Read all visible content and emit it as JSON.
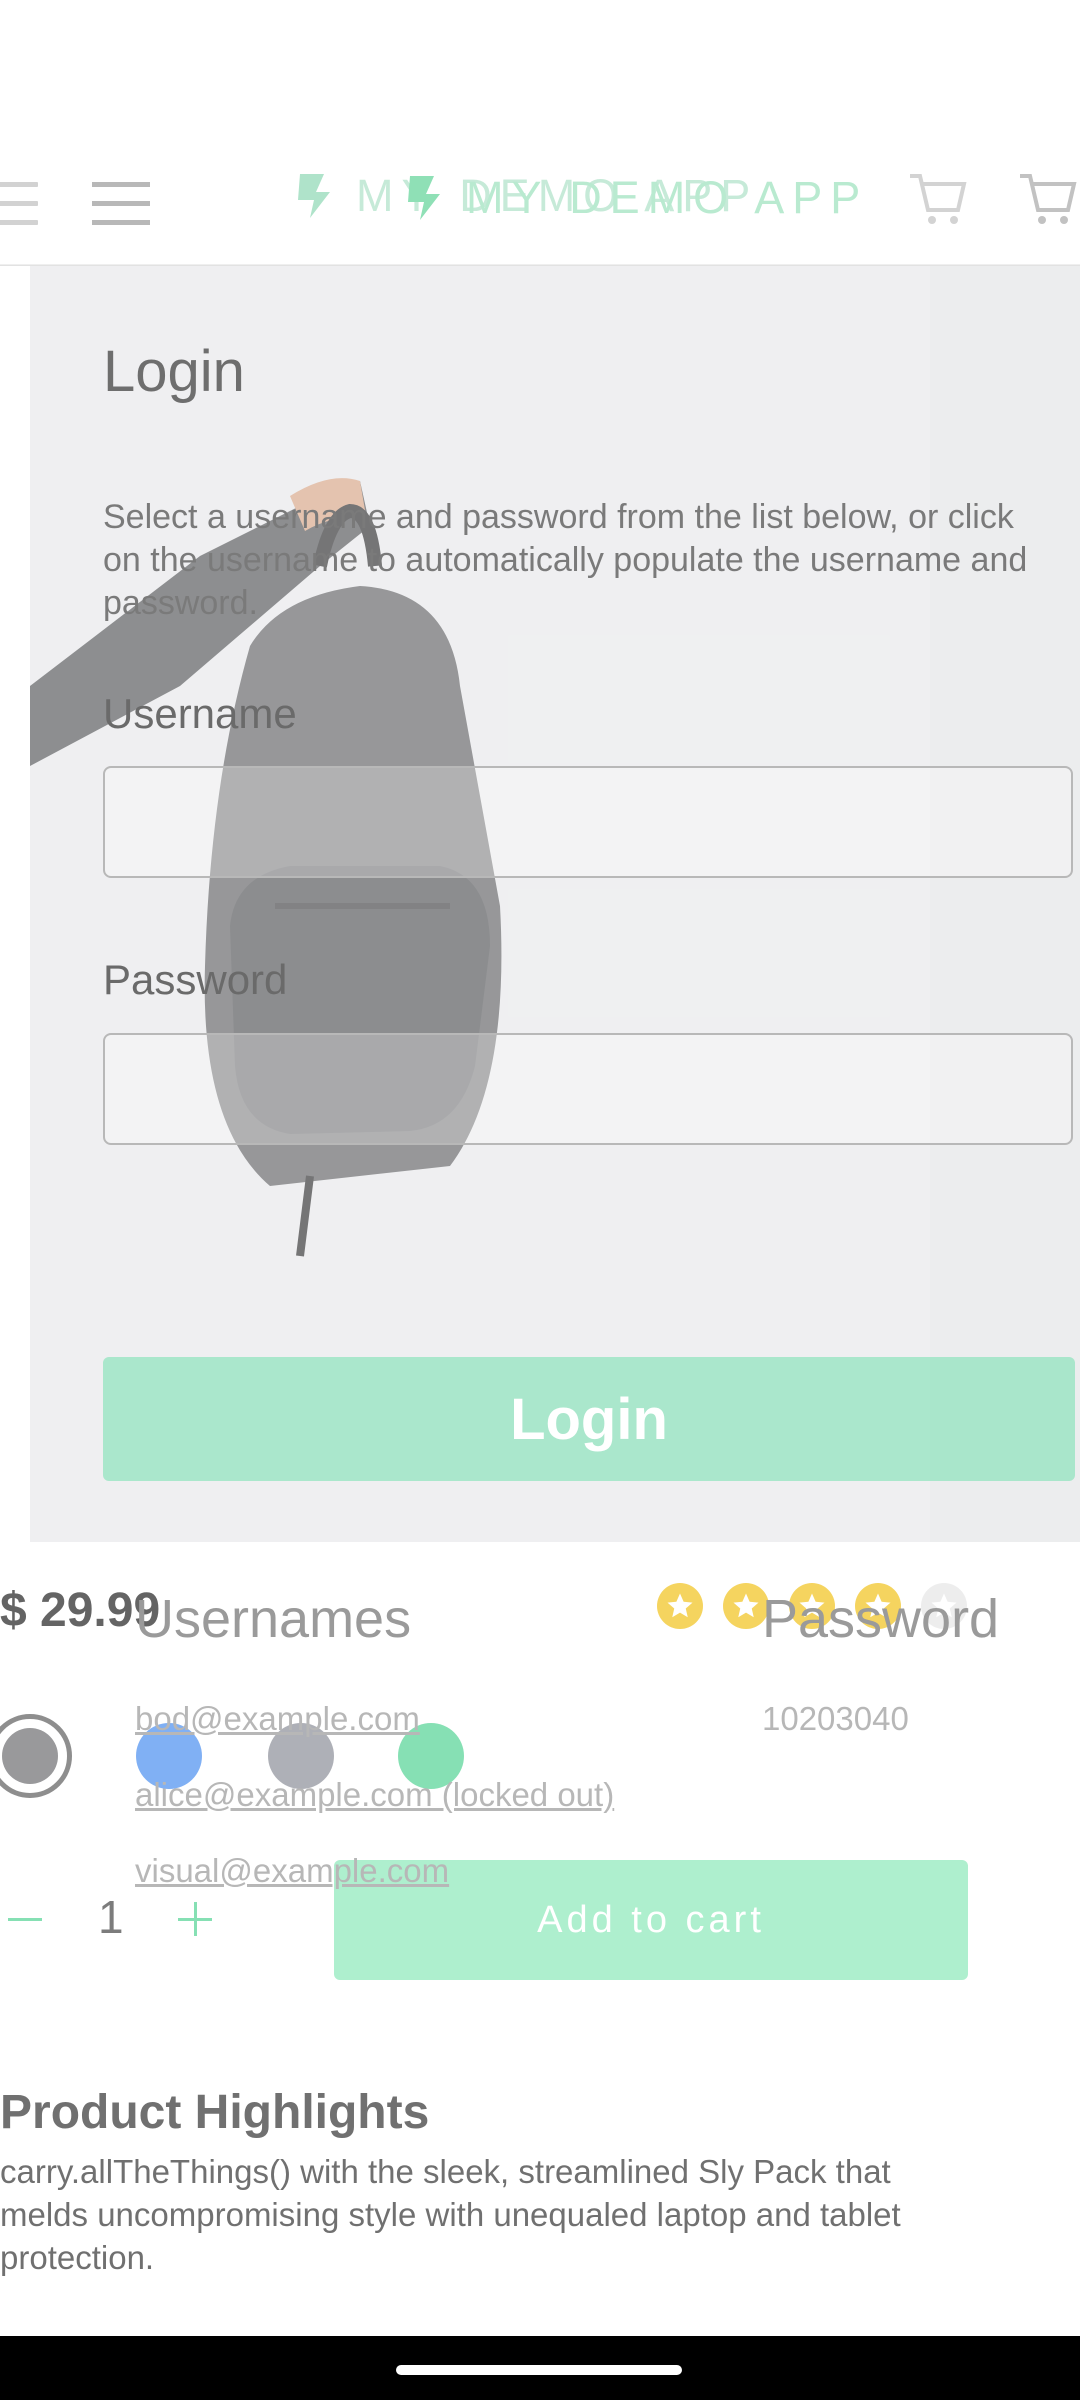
{
  "header": {
    "back_logo_text": "MY DEMO APP",
    "front_logo_text": "MY DEMO APP"
  },
  "product": {
    "price": "$ 29.99",
    "rating": 4,
    "rating_max": 5,
    "swatch_colors": [
      "#5e5e5e",
      "#4a8ef0",
      "#8c8f99",
      "#52d394"
    ],
    "quantity": "1",
    "add_to_cart_label": "Add to cart",
    "highlights_title": "Product Highlights",
    "highlights_text": "carry.allTheThings() with the sleek, streamlined Sly Pack that melds uncompromising style with unequaled laptop and tablet protection."
  },
  "login": {
    "title": "Login",
    "description": "Select a username and password from the list below, or click on the username to automatically populate the username and password.",
    "username_label": "Username",
    "username_value": "",
    "password_label": "Password",
    "password_value": "",
    "button_label": "Login",
    "usernames_header": "Usernames",
    "password_header": "Password",
    "usernames": [
      "bod@example.com",
      "alice@example.com (locked out)",
      "visual@example.com"
    ],
    "password_value_list": "10203040"
  },
  "colors": {
    "accent": "#52d394",
    "logo_back": "#2fb874",
    "logo_front": "#b9ead0"
  }
}
